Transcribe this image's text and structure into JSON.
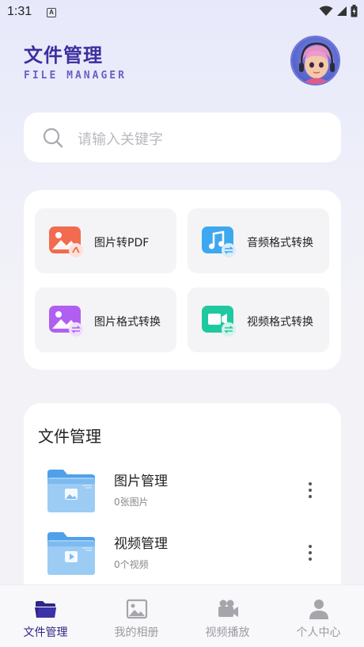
{
  "status_bar": {
    "time": "1:31",
    "notification_letter": "A"
  },
  "header": {
    "title": "文件管理",
    "subtitle": "FILE MANAGER"
  },
  "search": {
    "placeholder": "请输入关键字"
  },
  "tools": [
    {
      "label": "图片转PDF",
      "icon": "image-to-pdf-icon",
      "color": "#f26b4f"
    },
    {
      "label": "音频格式转换",
      "icon": "audio-convert-icon",
      "color": "#3ea8ef"
    },
    {
      "label": "图片格式转换",
      "icon": "image-convert-icon",
      "color": "#b05ff0"
    },
    {
      "label": "视频格式转换",
      "icon": "video-convert-icon",
      "color": "#1fc9a0"
    }
  ],
  "files": {
    "title": "文件管理",
    "items": [
      {
        "name": "图片管理",
        "count": "0张图片",
        "icon": "image-folder-icon"
      },
      {
        "name": "视频管理",
        "count": "0个视频",
        "icon": "video-folder-icon"
      }
    ]
  },
  "nav": [
    {
      "label": "文件管理",
      "icon": "folder-icon",
      "active": true
    },
    {
      "label": "我的相册",
      "icon": "album-icon",
      "active": false
    },
    {
      "label": "视频播放",
      "icon": "camera-icon",
      "active": false
    },
    {
      "label": "个人中心",
      "icon": "user-icon",
      "active": false
    }
  ],
  "colors": {
    "accent": "#2e2688",
    "title": "#3d2fa0",
    "inactive_nav": "#9a9aa2"
  }
}
